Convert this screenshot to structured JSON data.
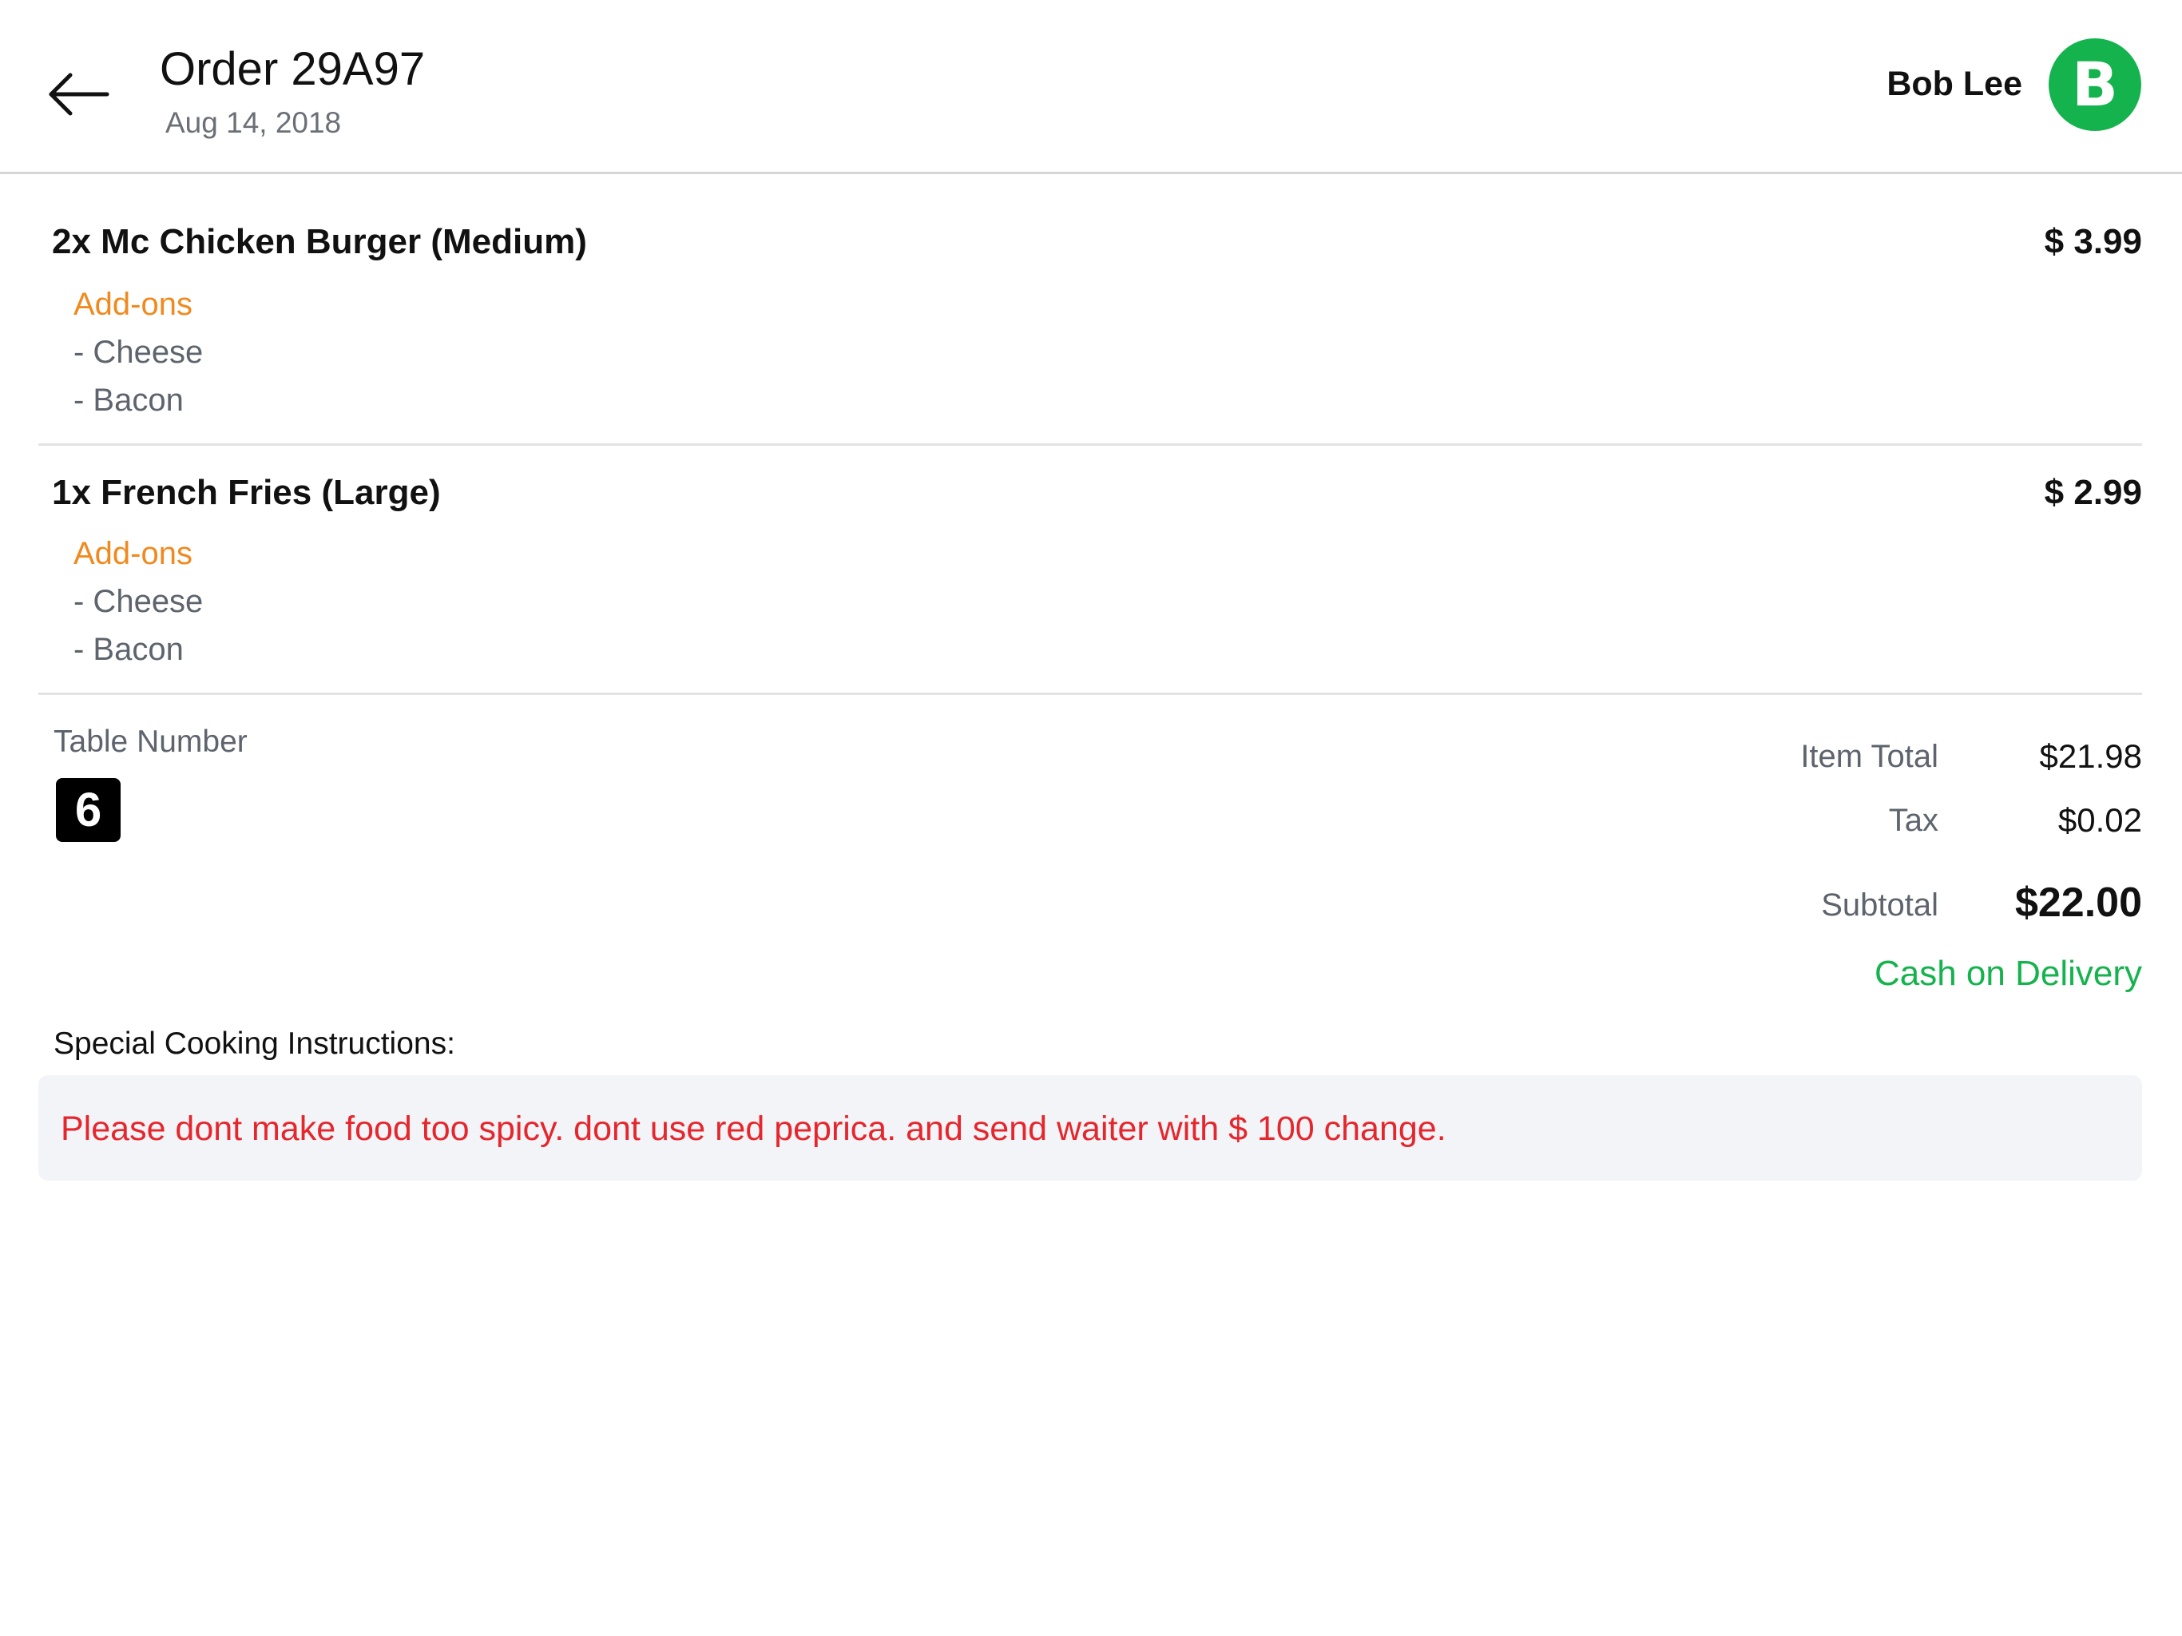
{
  "header": {
    "back_icon": "arrow-left-icon",
    "title": "Order 29A97",
    "date": "Aug 14, 2018",
    "user_name": "Bob Lee",
    "avatar_initial": "B",
    "avatar_color": "#15b34d"
  },
  "items": [
    {
      "name": "2x Mc Chicken Burger (Medium)",
      "price": "$ 3.99",
      "addons_label": "Add-ons",
      "addons": [
        "- Cheese",
        "- Bacon"
      ]
    },
    {
      "name": "1x French Fries (Large)",
      "price": "$ 2.99",
      "addons_label": "Add-ons",
      "addons": [
        "- Cheese",
        "- Bacon"
      ]
    }
  ],
  "table": {
    "label": "Table Number",
    "number": "6"
  },
  "summary": {
    "item_total_label": "Item Total",
    "item_total": "$21.98",
    "tax_label": "Tax",
    "tax": "$0.02",
    "subtotal_label": "Subtotal",
    "subtotal": "$22.00",
    "payment_method": "Cash on Delivery"
  },
  "instructions": {
    "label": "Special Cooking Instructions:",
    "text": "Please dont make food too spicy. dont use red peprica. and send waiter with $ 100 change."
  },
  "colors": {
    "addons_accent": "#f08a1f",
    "payment_green": "#15b34d",
    "instructions_red": "#e6262d"
  }
}
